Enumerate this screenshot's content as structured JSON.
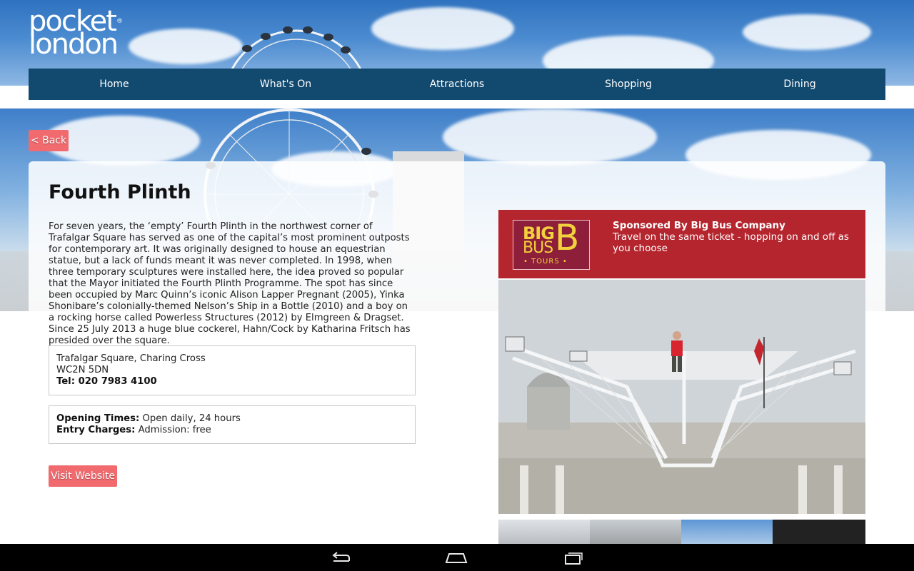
{
  "brand": {
    "logo_line1": "pocket",
    "logo_line2": "london",
    "logo_mark": "®"
  },
  "nav": [
    {
      "label": "Home"
    },
    {
      "label": "What's On"
    },
    {
      "label": "Attractions"
    },
    {
      "label": "Shopping"
    },
    {
      "label": "Dining"
    }
  ],
  "back_label": "< Back",
  "page_title": "Fourth Plinth",
  "description": "For seven years, the ‘empty’ Fourth Plinth in the northwest corner of Trafalgar Square has served as one of the capital’s most prominent outposts for contemporary art. It was originally designed to house an equestrian statue, but a lack of funds meant it was never completed. In 1998, when three temporary sculptures were installed here, the idea proved so popular that the Mayor initiated the Fourth Plinth Programme. The spot has since been occupied by Marc Quinn’s iconic Alison Lapper Pregnant (2005), Yinka Shonibare’s colonially-themed Nelson’s Ship in a Bottle (2010) and a boy on a rocking horse called Powerless Structures (2012) by Elmgreen & Dragset. Since 25 July 2013 a huge blue cockerel, Hahn/Cock by Katharina Fritsch has presided over the square.",
  "address": {
    "line1": "Trafalgar Square, Charing Cross",
    "line2": "WC2N 5DN",
    "tel": "Tel: 020 7983 4100"
  },
  "details": {
    "opening_label": "Opening Times:",
    "opening_value": " Open daily, 24 hours",
    "charges_label": "Entry Charges:",
    "charges_value": " Admission: free"
  },
  "visit_label": "Visit Website",
  "sponsor": {
    "logo_big": "BIG",
    "logo_bus": "BUS",
    "logo_b": "B",
    "logo_tours": "• TOURS •",
    "title": "Sponsored By Big Bus Company",
    "text": "Travel on the same ticket - hopping on and off as you choose"
  },
  "colors": {
    "nav_bg": "#124a6f",
    "button_bg": "#f06a6e",
    "sponsor_bg": "#b5252e",
    "logo_yellow": "#f2d23c"
  },
  "icons": {
    "back": "back-arrow-icon",
    "home": "home-icon",
    "recents": "recent-apps-icon"
  }
}
